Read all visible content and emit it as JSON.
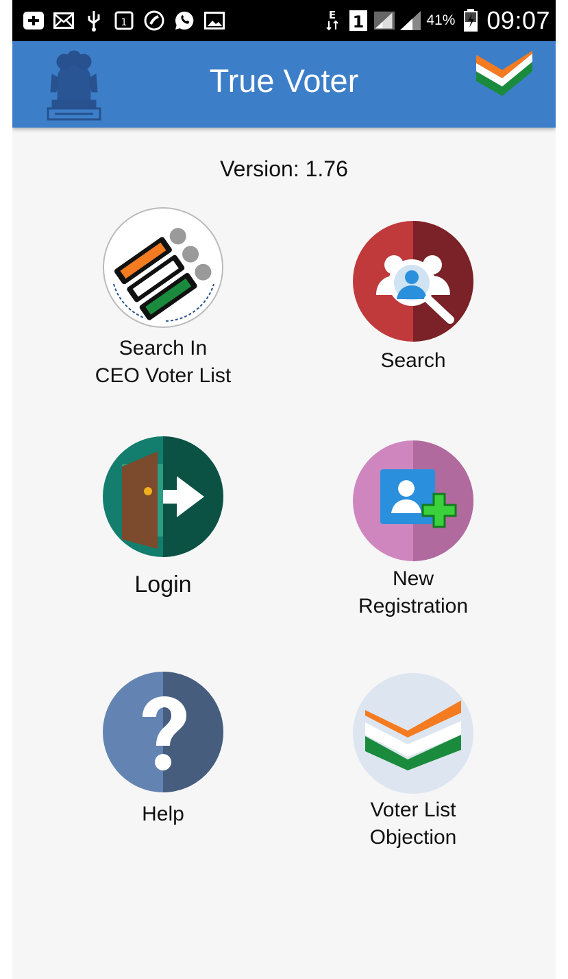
{
  "status_bar": {
    "battery_percent": "41%",
    "time": "09:07",
    "network_label": "E",
    "sim_label": "1",
    "icons": [
      "back-icon",
      "mail-icon",
      "usb-icon",
      "calendar-icon",
      "phone-call-icon",
      "whatsapp-icon",
      "image-icon",
      "data-icon",
      "sim-icon",
      "signal-icon",
      "signal-icon",
      "battery-icon"
    ]
  },
  "appbar": {
    "title": "True Voter"
  },
  "version_text": "Version: 1.76",
  "tiles": [
    {
      "line1": "Search In",
      "line2": "CEO Voter List",
      "icon": "eci-logo-icon"
    },
    {
      "line1": "Search",
      "line2": "",
      "icon": "people-search-icon"
    },
    {
      "line1": "Login",
      "line2": "",
      "icon": "login-door-icon"
    },
    {
      "line1": "New",
      "line2": "Registration",
      "icon": "add-user-icon"
    },
    {
      "line1": "Help",
      "line2": "",
      "icon": "help-question-icon"
    },
    {
      "line1": "Voter List",
      "line2": "Objection",
      "icon": "tricolor-check-icon"
    }
  ],
  "colors": {
    "appbar": "#3d7ec8",
    "search_red": "#c0393b",
    "login_teal": "#137e6d",
    "register_pink": "#cf86bf",
    "help_blue": "#6384b3",
    "saffron": "#f47b20",
    "green": "#1a8b3c"
  }
}
